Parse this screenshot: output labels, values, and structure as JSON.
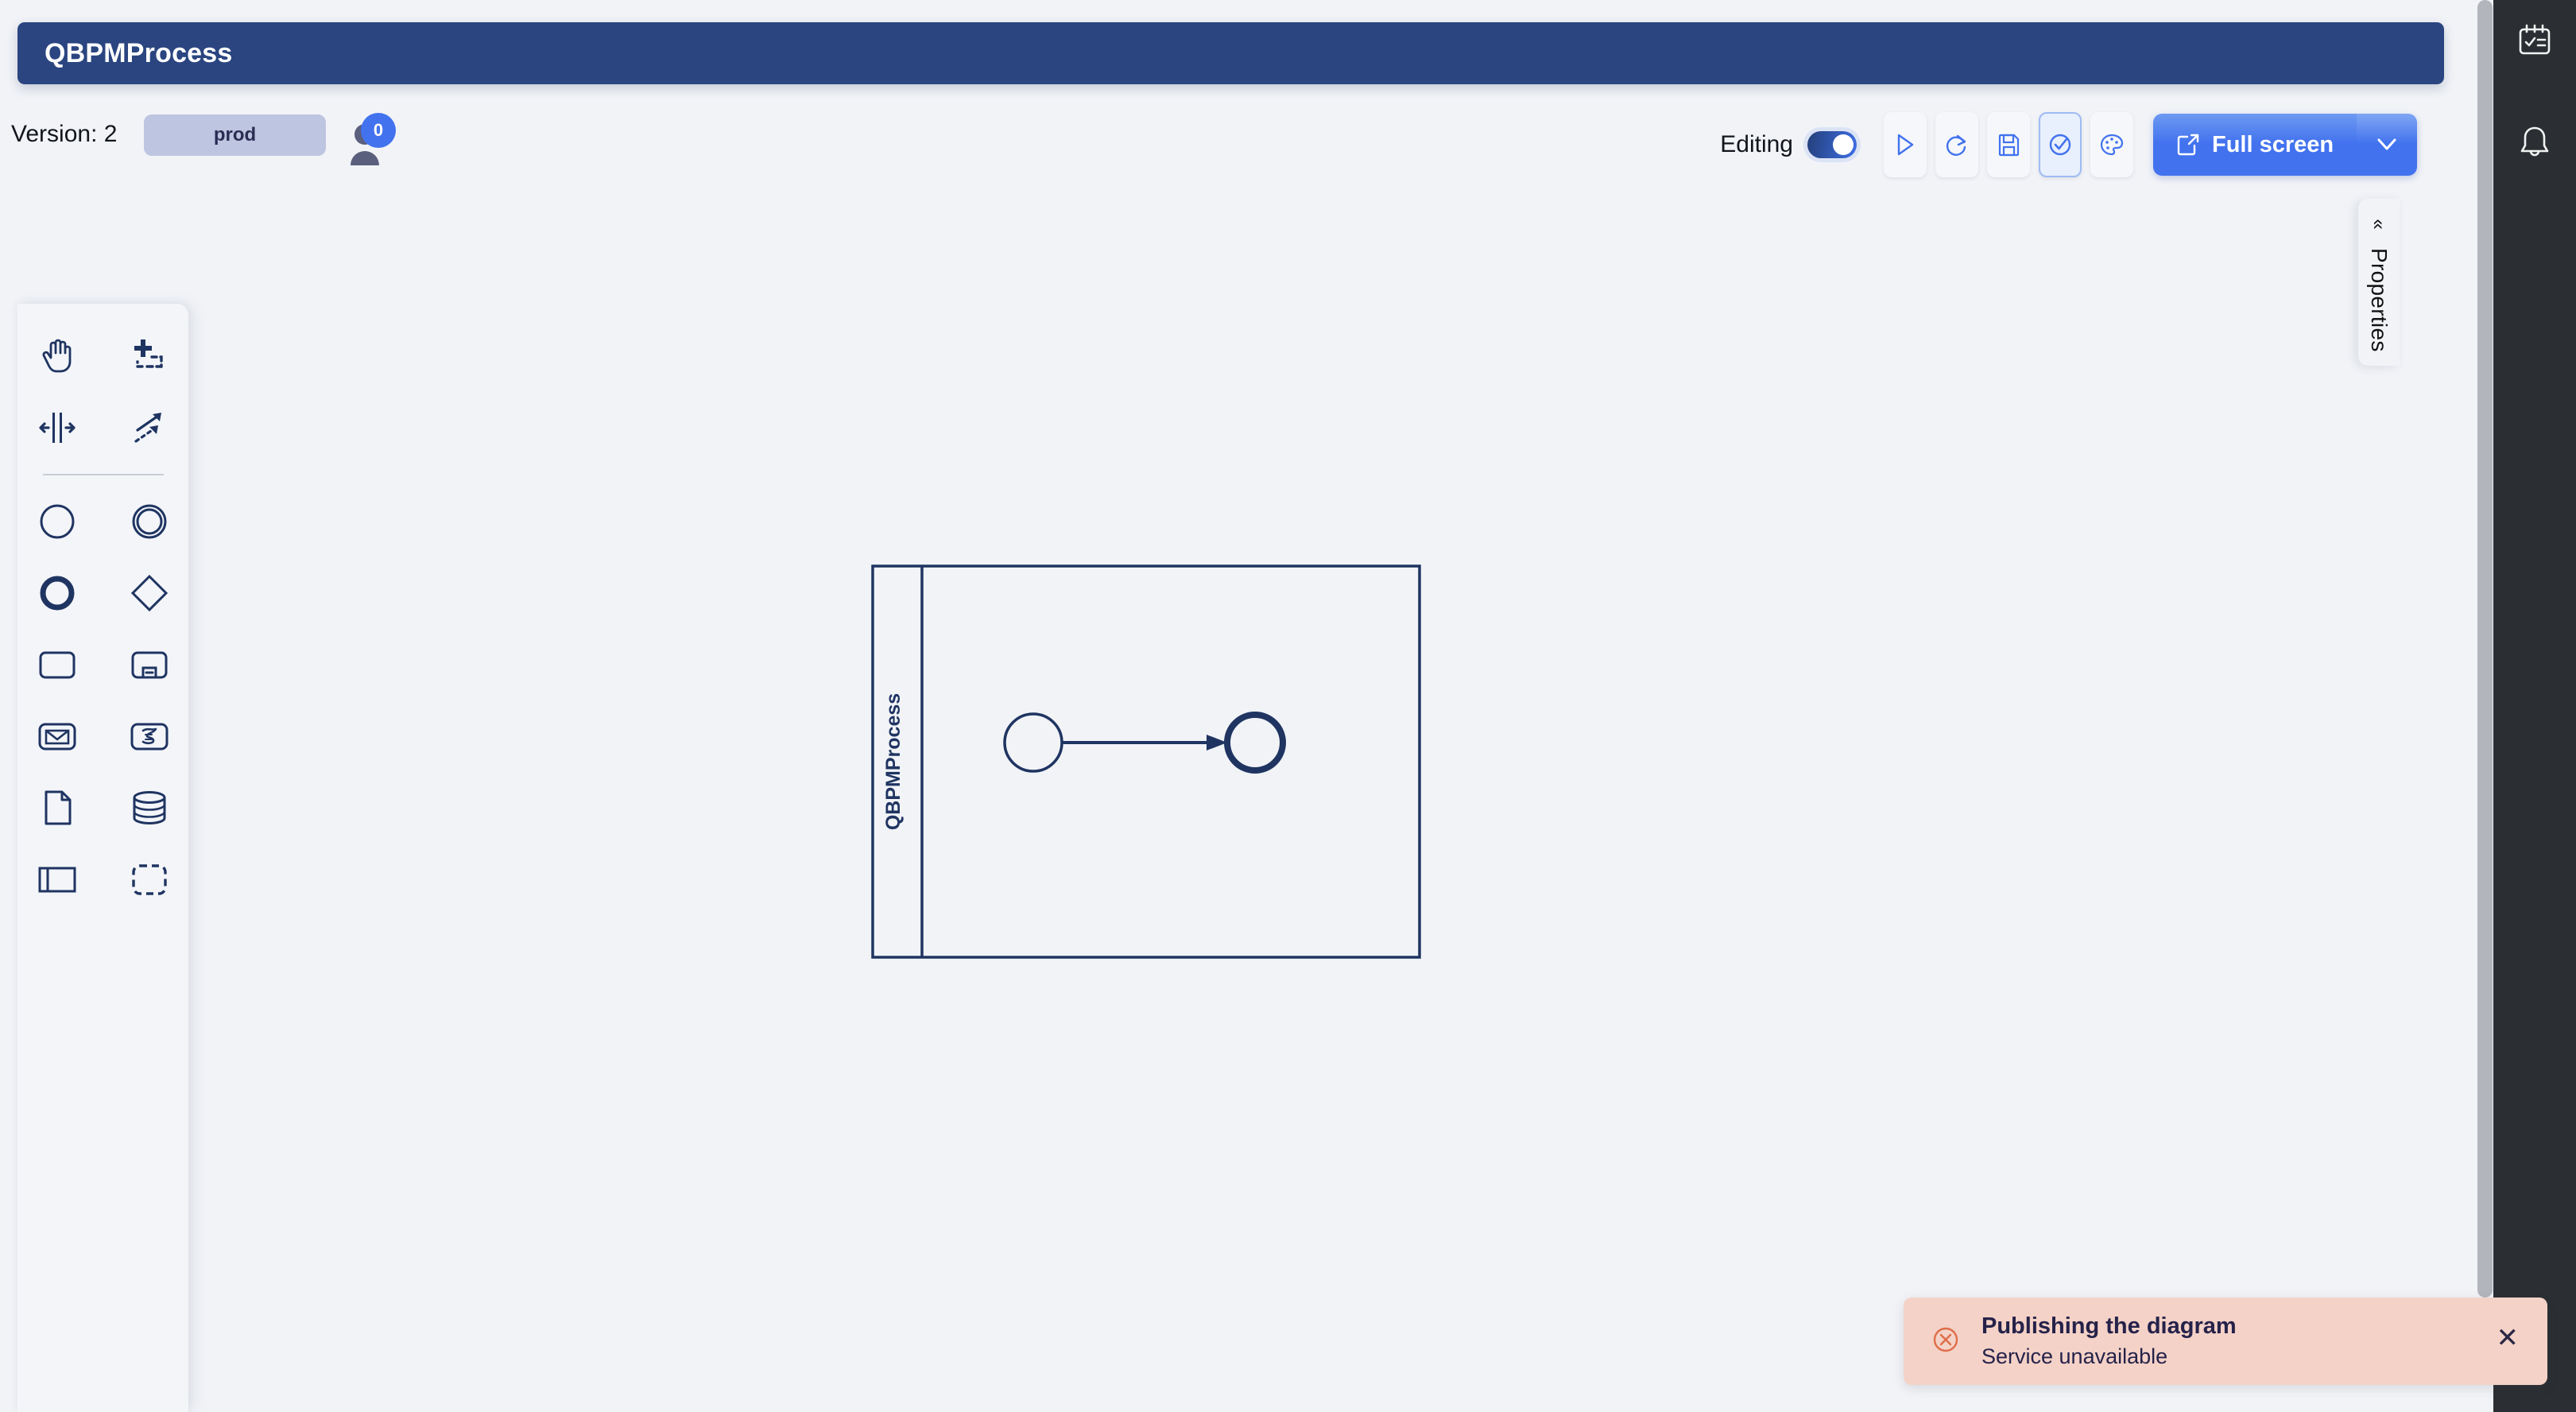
{
  "header": {
    "title": "QBPMProcess",
    "version_label": "Version: 2",
    "env_badge": "prod",
    "presence_count": "0"
  },
  "toolbar": {
    "editing_label": "Editing",
    "editing_on": true,
    "buttons": [
      {
        "name": "run-button",
        "icon": "play-icon",
        "active": false
      },
      {
        "name": "redo-button",
        "icon": "redo-icon",
        "active": false
      },
      {
        "name": "save-button",
        "icon": "floppy-disk-icon",
        "active": false
      },
      {
        "name": "validate-button",
        "icon": "check-circle-icon",
        "active": true
      },
      {
        "name": "theme-button",
        "icon": "palette-icon",
        "active": false
      }
    ],
    "fullscreen_label": "Full screen",
    "fullscreen_icon": "external-link-icon",
    "fullscreen_caret": "chevron-down-icon"
  },
  "palette": {
    "groups": [
      {
        "items": [
          {
            "name": "hand-tool",
            "icon": "hand-icon"
          },
          {
            "name": "lasso-tool",
            "icon": "lasso-select-icon"
          },
          {
            "name": "space-tool",
            "icon": "space-tool-icon"
          },
          {
            "name": "connect-tool",
            "icon": "global-connect-icon"
          }
        ]
      },
      {
        "items": [
          {
            "name": "start-event-tool",
            "icon": "start-event-icon"
          },
          {
            "name": "intermediate-event-tool",
            "icon": "intermediate-event-icon"
          },
          {
            "name": "end-event-tool",
            "icon": "end-event-icon"
          },
          {
            "name": "gateway-tool",
            "icon": "gateway-diamond-icon"
          },
          {
            "name": "task-tool",
            "icon": "task-icon"
          },
          {
            "name": "subprocess-tool",
            "icon": "subprocess-icon"
          },
          {
            "name": "message-task-tool",
            "icon": "envelope-icon"
          },
          {
            "name": "script-task-tool",
            "icon": "script-icon"
          },
          {
            "name": "data-object-tool",
            "icon": "data-object-icon"
          },
          {
            "name": "data-store-tool",
            "icon": "data-store-icon"
          },
          {
            "name": "participant-tool",
            "icon": "pool-icon"
          },
          {
            "name": "group-tool",
            "icon": "group-dashed-icon"
          }
        ]
      }
    ]
  },
  "diagram": {
    "pool_label": "QBPMProcess",
    "nodes": [
      {
        "name": "start-event",
        "type": "start-event"
      },
      {
        "name": "end-event",
        "type": "end-event"
      }
    ],
    "flows": [
      {
        "name": "sequence-flow",
        "from": "start-event",
        "to": "end-event"
      }
    ]
  },
  "properties_panel": {
    "label": "Properties",
    "collapse_icon": "chevron-double-left-icon"
  },
  "rail": {
    "items": [
      {
        "name": "tasks-icon",
        "label": "tasks"
      },
      {
        "name": "bell-icon",
        "label": "notifications"
      }
    ]
  },
  "toast": {
    "icon": "error-circle-x-icon",
    "title": "Publishing the diagram",
    "message": "Service unavailable",
    "close_icon": "close-icon"
  },
  "colors": {
    "header_navy": "#2A4580",
    "accent_blue": "#4272EE",
    "badge_periwinkle": "#BDC5E0",
    "canvas_bg": "#F1F3F7",
    "bpmn_stroke": "#1F3461",
    "toast_bg": "#F4D2C7",
    "toast_icon": "#E2714B",
    "rail_dark": "#2B2F33"
  }
}
